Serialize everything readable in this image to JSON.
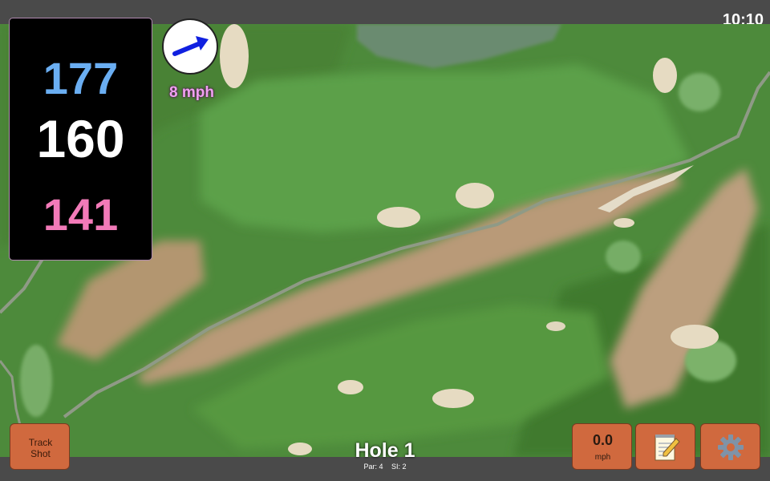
{
  "status": {
    "time": "10:10"
  },
  "distances": {
    "back": "177",
    "middle": "160",
    "front": "141",
    "colors": {
      "back": "#6aaef2",
      "middle": "#ffffff",
      "front": "#f27ab8"
    }
  },
  "wind": {
    "speed_label": "8 mph",
    "icon": "wind-direction-arrow-icon"
  },
  "controls": {
    "track_shot": {
      "line1": "Track",
      "line2": "Shot"
    },
    "speed": {
      "value": "0.0",
      "unit": "mph"
    },
    "notes_icon": "notepad-icon",
    "settings_icon": "gear-icon",
    "button_color": "#d0693e"
  },
  "hole": {
    "title": "Hole 1",
    "par": "Par: 4",
    "si": "SI: 2"
  }
}
